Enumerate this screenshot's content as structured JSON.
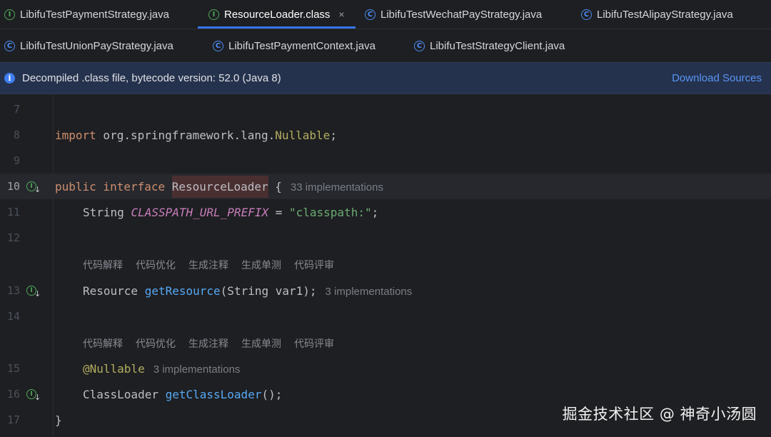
{
  "tabs_row1": [
    {
      "label": "LibifuTestPaymentStrategy.java",
      "icon": "interface-file-icon",
      "active": false
    },
    {
      "label": "ResourceLoader.class",
      "icon": "interface-file-icon",
      "active": true,
      "close": "×"
    },
    {
      "label": "LibifuTestWechatPayStrategy.java",
      "icon": "class-file-icon",
      "active": false
    },
    {
      "label": "LibifuTestAlipayStrategy.java",
      "icon": "class-file-icon",
      "active": false
    }
  ],
  "tabs_row2": [
    {
      "label": "LibifuTestUnionPayStrategy.java",
      "icon": "class-file-icon"
    },
    {
      "label": "LibifuTestPaymentContext.java",
      "icon": "class-file-icon"
    },
    {
      "label": "LibifuTestStrategyClient.java",
      "icon": "class-file-icon"
    }
  ],
  "banner": {
    "message": "Decompiled .class file, bytecode version: 52.0 (Java 8)",
    "action": "Download Sources",
    "icon": "info-icon"
  },
  "editor": {
    "line_numbers": [
      "7",
      "8",
      "9",
      "10",
      "11",
      "12",
      "13",
      "14",
      "15",
      "16",
      "17"
    ],
    "line8": {
      "kw": "import",
      "pkg": " org.springframework.lang.",
      "cls": "Nullable",
      "end": ";"
    },
    "line10": {
      "kw": "public interface",
      "name": "ResourceLoader",
      "brace": " {",
      "hint": "33 implementations"
    },
    "line11": {
      "type": "String ",
      "const": "CLASSPATH_URL_PREFIX",
      "eq": " = ",
      "str": "\"classpath:\"",
      "end": ";"
    },
    "line13": {
      "type": "Resource ",
      "meth": "getResource",
      "args": "(String var1);",
      "hint": "3 implementations"
    },
    "line15": {
      "ann": "@Nullable",
      "hint": "3 implementations"
    },
    "line16": {
      "type": "ClassLoader ",
      "meth": "getClassLoader",
      "args": "();"
    },
    "line17": {
      "text": "}"
    },
    "ai_actions": [
      "代码解释",
      "代码优化",
      "生成注释",
      "生成单测",
      "代码评审"
    ]
  },
  "watermark": "掘金技术社区 @ 神奇小汤圆",
  "colors": {
    "accent": "#3574f0",
    "keyword": "#cf8e6d",
    "method": "#56a8f5",
    "string": "#6aab73",
    "constant": "#c77dbb",
    "annotation": "#b3ae60"
  }
}
